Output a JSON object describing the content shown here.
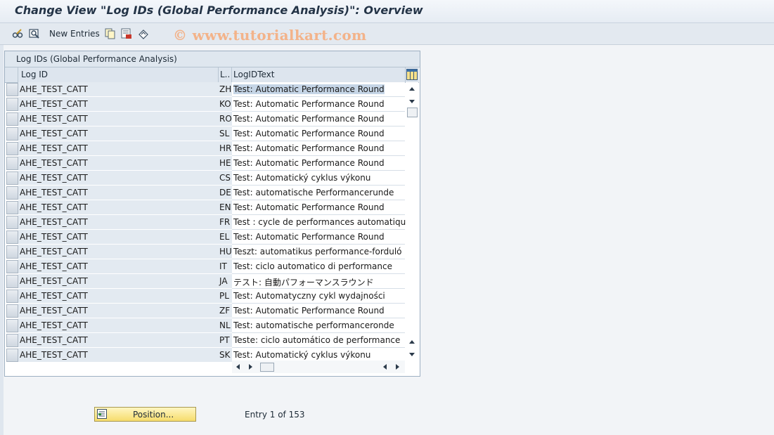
{
  "window": {
    "title": "Change View \"Log IDs (Global Performance Analysis)\": Overview"
  },
  "toolbar": {
    "icons": [
      "glasses-edit-icon",
      "display-change-icon",
      "copy-icon",
      "delete-icon",
      "undo-icon"
    ],
    "new_entries_label": "New Entries",
    "watermark": "© www.tutorialkart.com"
  },
  "table": {
    "panel_title": "Log IDs (Global Performance Analysis)",
    "columns": [
      "Log ID",
      "L..",
      "LogIDText"
    ],
    "rows": [
      {
        "id": "AHE_TEST_CATT",
        "lang": "ZH",
        "text": "Test: Automatic Performance Round"
      },
      {
        "id": "AHE_TEST_CATT",
        "lang": "KO",
        "text": "Test: Automatic Performance Round"
      },
      {
        "id": "AHE_TEST_CATT",
        "lang": "RO",
        "text": "Test: Automatic Performance Round"
      },
      {
        "id": "AHE_TEST_CATT",
        "lang": "SL",
        "text": "Test: Automatic Performance Round"
      },
      {
        "id": "AHE_TEST_CATT",
        "lang": "HR",
        "text": "Test: Automatic Performance Round"
      },
      {
        "id": "AHE_TEST_CATT",
        "lang": "HE",
        "text": "Test: Automatic Performance Round"
      },
      {
        "id": "AHE_TEST_CATT",
        "lang": "CS",
        "text": "Test: Automatický cyklus výkonu"
      },
      {
        "id": "AHE_TEST_CATT",
        "lang": "DE",
        "text": "Test: automatische Performancerunde"
      },
      {
        "id": "AHE_TEST_CATT",
        "lang": "EN",
        "text": "Test: Automatic Performance Round"
      },
      {
        "id": "AHE_TEST_CATT",
        "lang": "FR",
        "text": "Test : cycle de performances automatique"
      },
      {
        "id": "AHE_TEST_CATT",
        "lang": "EL",
        "text": "Test: Automatic Performance Round"
      },
      {
        "id": "AHE_TEST_CATT",
        "lang": "HU",
        "text": "Teszt: automatikus performance-forduló"
      },
      {
        "id": "AHE_TEST_CATT",
        "lang": "IT",
        "text": "Test: ciclo automatico di performance"
      },
      {
        "id": "AHE_TEST_CATT",
        "lang": "JA",
        "text": "テスト: 自動パフォーマンスラウンド"
      },
      {
        "id": "AHE_TEST_CATT",
        "lang": "PL",
        "text": "Test: Automatyczny cykl wydajności"
      },
      {
        "id": "AHE_TEST_CATT",
        "lang": "ZF",
        "text": "Test: Automatic Performance Round"
      },
      {
        "id": "AHE_TEST_CATT",
        "lang": "NL",
        "text": "Test: automatische performanceronde"
      },
      {
        "id": "AHE_TEST_CATT",
        "lang": "PT",
        "text": "Teste: ciclo automático de performance"
      },
      {
        "id": "AHE_TEST_CATT",
        "lang": "SK",
        "text": "Test: Automatický cyklus výkonu"
      }
    ]
  },
  "footer": {
    "position_button": "Position...",
    "entry_info": "Entry 1 of 153"
  }
}
